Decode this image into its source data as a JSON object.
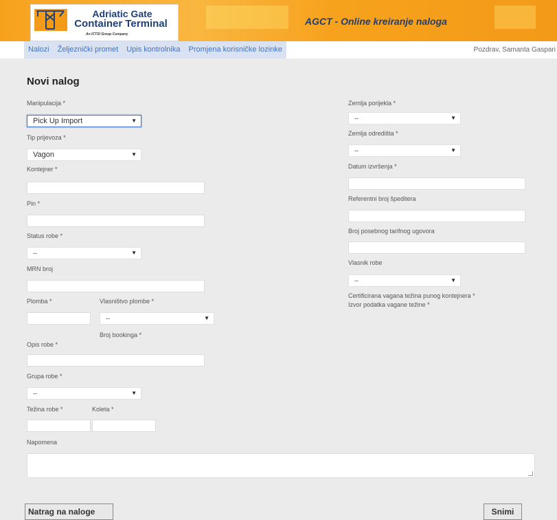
{
  "header": {
    "logo_line1": "Adriatic Gate",
    "logo_line2": "Container Terminal",
    "logo_sub": "An ICTSI Group Company",
    "app_title": "AGCT - Online kreiranje naloga"
  },
  "nav": {
    "items": [
      {
        "label": "Nalozi"
      },
      {
        "label": "Željeznički promet"
      },
      {
        "label": "Upis kontrolnika"
      },
      {
        "label": "Promjena korisničke lozinke"
      }
    ],
    "greeting": "Pozdrav, Samanta Gaspari"
  },
  "page_title": "Novi nalog",
  "form": {
    "manipulacija": {
      "label": "Manipulacija *",
      "value": "Pick Up Import"
    },
    "tip_prijevoza": {
      "label": "Tip prijevoza *",
      "value": "Vagon"
    },
    "kontejner": {
      "label": "Kontejner *",
      "value": ""
    },
    "pin": {
      "label": "Pin *",
      "value": ""
    },
    "status_robe": {
      "label": "Status robe *",
      "value": "--"
    },
    "mrn_broj": {
      "label": "MRN broj",
      "value": ""
    },
    "plomba": {
      "label": "Plomba *",
      "value": ""
    },
    "vlasnistvo_plombe": {
      "label": "Vlasništvo plombe *",
      "value": "--"
    },
    "broj_bookinga": {
      "label": "Broj bookinga *"
    },
    "opis_robe": {
      "label": "Opis robe *",
      "value": ""
    },
    "grupa_robe": {
      "label": "Grupa robe *",
      "value": "--"
    },
    "tezina_robe": {
      "label": "Težina robe *",
      "value": ""
    },
    "koleta": {
      "label": "Koleta *",
      "value": ""
    },
    "napomena": {
      "label": "Napomena",
      "value": ""
    },
    "zemlja_porijekla": {
      "label": "Zemlja porijekla *",
      "value": "--"
    },
    "zemlja_odredista": {
      "label": "Zemlja odredišta *",
      "value": "--"
    },
    "datum_izvrsenja": {
      "label": "Datum izvršenja *",
      "value": ""
    },
    "referentni_broj": {
      "label": "Referentni broj špeditera",
      "value": ""
    },
    "broj_ugovora": {
      "label": "Broj posebnog tarifnog ugovora",
      "value": ""
    },
    "vlasnik_robe": {
      "label": "Vlasnik robe",
      "value": "--"
    },
    "certificirana_tezina": {
      "label": "Certificirana vagana težina punog kontejnera *"
    },
    "izvor_podatka": {
      "label": "Izvor podatka vagane težine *"
    }
  },
  "buttons": {
    "back": "Natrag na naloge",
    "save": "Snimi"
  },
  "colors": {
    "header_orange": "#f7a21d",
    "brand_navy": "#1f3f75",
    "nav_link": "#4472c4",
    "nav_bg": "#d8e2f0"
  }
}
